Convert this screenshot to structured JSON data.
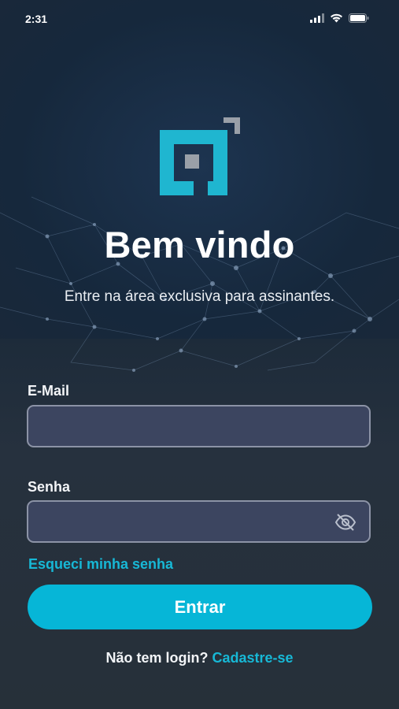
{
  "status_bar": {
    "time": "2:31",
    "icons": [
      "signal-icon",
      "wifi-icon",
      "battery-icon"
    ]
  },
  "header": {
    "title": "Bem vindo",
    "subtitle": "Entre na área exclusiva para assinantes."
  },
  "form": {
    "email_label": "E-Mail",
    "email_value": "",
    "password_label": "Senha",
    "password_value": "",
    "password_toggle_icon": "eye-off-icon",
    "forgot_link": "Esqueci minha senha",
    "submit_label": "Entrar"
  },
  "footer": {
    "prompt": "Não tem login?",
    "signup_link": "Cadastre-se"
  },
  "colors": {
    "accent": "#06b6d7",
    "link": "#17b8d6",
    "field_bg": "#3c4560",
    "field_border": "#8c93a6",
    "logo_gray": "#9aa0a8"
  }
}
